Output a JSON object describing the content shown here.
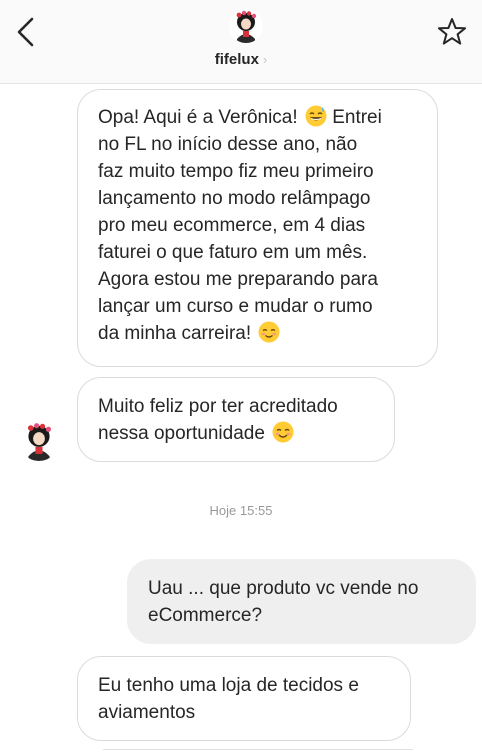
{
  "header": {
    "username": "fifelux",
    "chevron": "›",
    "back_icon": "chevron-left-icon",
    "star_icon": "star-outline-icon"
  },
  "messages": [
    {
      "direction": "incoming",
      "text": "Opa! Aqui é a Verônica! 😅 Entrei no FL no início desse ano, não faz muito tempo fiz meu primeiro lançamento no modo relâmpago pro meu ecommerce, em 4 dias faturei o que faturo em um mês. Agora estou me preparando para lançar um curso e mudar o rumo da minha carreira! ☺️",
      "lines": [
        "Opa! Aqui é a Verônica!",
        "Entrei",
        "no FL no início desse ano, não",
        "faz muito tempo fiz meu primeiro",
        "lançamento no modo relâmpago",
        "pro meu ecommerce, em 4 dias",
        "faturei o que faturo em um mês.",
        "Agora estou me preparando para",
        "lançar um curso e mudar o rumo",
        "da minha carreira!"
      ]
    },
    {
      "direction": "incoming",
      "text": "Muito feliz por ter acreditado nessa oportunidade 😊",
      "lines": [
        "Muito feliz por ter acreditado",
        "nessa oportunidade"
      ]
    },
    {
      "direction": "outgoing",
      "text": "Uau ... que produto vc vende no eCommerce?",
      "lines": [
        "Uau ... que produto vc vende no",
        "eCommerce?"
      ]
    },
    {
      "direction": "incoming",
      "text": "Eu tenho uma loja de tecidos e aviamentos",
      "lines": [
        "Eu tenho uma loja de tecidos e",
        "aviamentos"
      ]
    }
  ],
  "timestamp": "Hoje 15:55",
  "colors": {
    "header_bg": "#fafafa",
    "incoming_border": "#dbdbdb",
    "outgoing_bg": "#efefef",
    "text": "#262626",
    "timestamp": "#999999",
    "emoji_yellow": "#ffcc33"
  }
}
